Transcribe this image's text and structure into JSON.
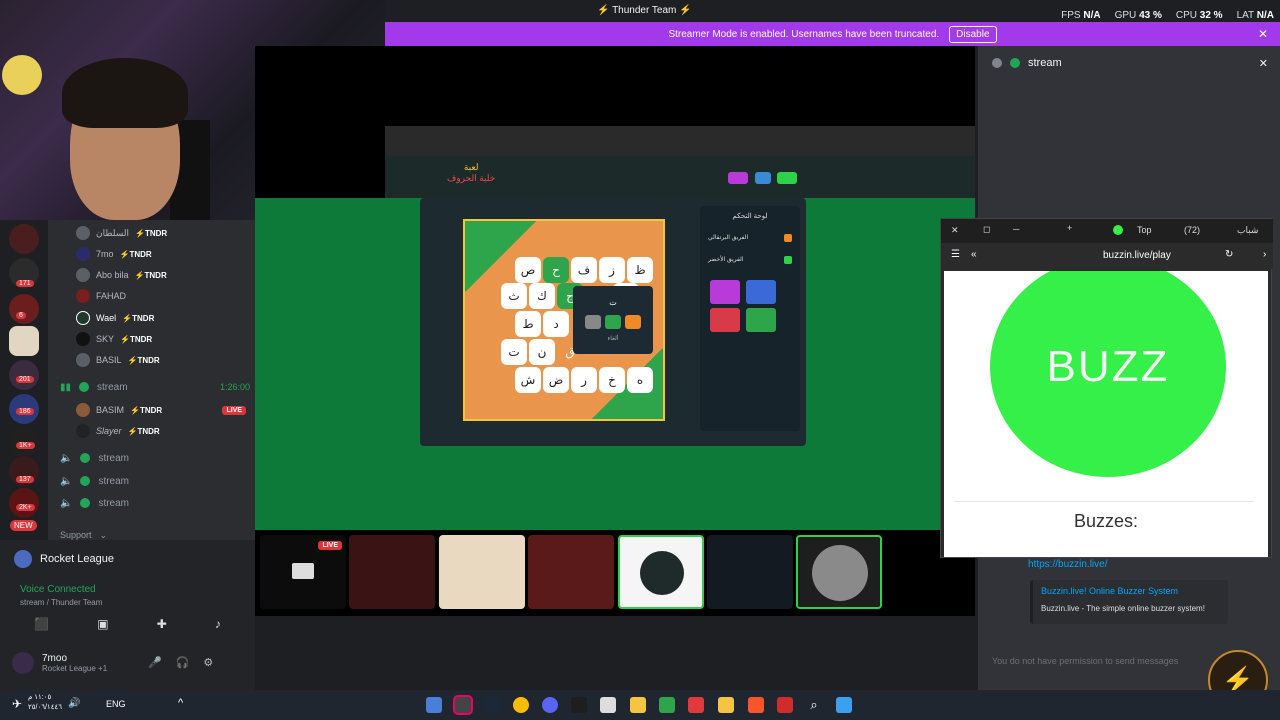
{
  "titlebar": {
    "title": "Thunder Team",
    "fps_label": "FPS",
    "fps_value": "N/A",
    "gpu_label": "GPU",
    "gpu_value": "43 %",
    "cpu_label": "CPU",
    "cpu_value": "32 %",
    "lat_label": "LAT",
    "lat_value": "N/A"
  },
  "banner": {
    "text": "Streamer Mode is enabled. Usernames have been truncated.",
    "disable_label": "Disable"
  },
  "rail": {
    "badges": [
      "171",
      "6",
      "201",
      "186",
      "1K+",
      "137",
      "2K+"
    ],
    "new_label": "NEW"
  },
  "channels": {
    "members_top": [
      {
        "name": "السلطان",
        "tag": "TNDR"
      },
      {
        "name": "7mo",
        "tag": "TNDR"
      },
      {
        "name": "Abo bila",
        "tag": "TNDR"
      },
      {
        "name": "FAHAD",
        "tag": ""
      },
      {
        "name": "Wael",
        "tag": "TNDR"
      },
      {
        "name": "SKY",
        "tag": "TNDR"
      },
      {
        "name": "BASIL",
        "tag": "TNDR"
      }
    ],
    "stream_channel": {
      "name": "stream",
      "timer": "1:26:00"
    },
    "members_stream": [
      {
        "name": "BASIM",
        "tag": "TNDR",
        "live": "LIVE"
      },
      {
        "name": "Slayer",
        "tag": "TNDR"
      }
    ],
    "voice_channels": [
      "stream",
      "stream",
      "stream"
    ],
    "support_label": "Support"
  },
  "user_area": {
    "activity": "Rocket League",
    "voice_status": "Voice Connected",
    "voice_sub": "stream / Thunder Team",
    "username": "7moo",
    "user_activity": "Rocket League +1"
  },
  "chat": {
    "header_channel": "stream",
    "link_url": "https://buzzin.live/",
    "link_title": "Buzzin.live! Online Buzzer System",
    "link_desc": "Buzzin.live - The simple online buzzer system!",
    "input_placeholder": "You do not have permission to send messages"
  },
  "popout": {
    "tab_label": "Top",
    "tab_count": "(72)",
    "tab_arabic": "شباب",
    "url": "buzzin.live/play",
    "buzz_label": "BUZZ",
    "buzzes_label": "Buzzes:"
  },
  "game": {
    "title_line1": "لعبة",
    "title_line2": "خلية الحروف",
    "panel_title": "لوحة التحكم",
    "team1": "الفريق البرتقالي",
    "team2": "الفريق الأخضر",
    "popup_letter": "ت",
    "popup_button": "ألغاء",
    "letters": [
      "ظ",
      "ز",
      "ف",
      "ح",
      "ص",
      "خ",
      "ج",
      "ك",
      "ث",
      "ل",
      "ط",
      "د",
      "ذ",
      "ق",
      "ن",
      "ت",
      "ه",
      "خ",
      "ر",
      "ض",
      "ش",
      "غ",
      "ع",
      "س"
    ]
  },
  "tiles": {
    "live_label": "LIVE"
  },
  "taskbar": {
    "lang": "ENG",
    "time": "١١:٠٥ م",
    "date": "٢٥/٠٦/١٤٤٦"
  }
}
